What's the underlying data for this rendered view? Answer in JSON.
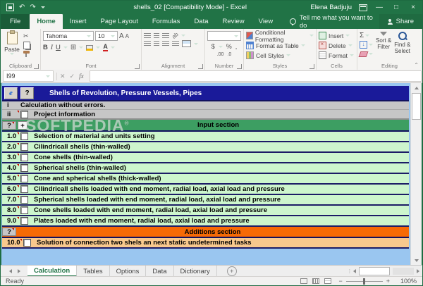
{
  "window": {
    "title": "shells_02  [Compatibility Mode] - Excel",
    "user": "Elena Badjuju"
  },
  "ribbon_tabs": {
    "file": "File",
    "items": [
      "Home",
      "Insert",
      "Page Layout",
      "Formulas",
      "Data",
      "Review",
      "View"
    ],
    "active": "Home",
    "tell_me": "Tell me what you want to do",
    "share": "Share"
  },
  "ribbon": {
    "clipboard": {
      "caption": "Clipboard",
      "paste": "Paste"
    },
    "font": {
      "caption": "Font",
      "family": "Tahoma",
      "size": "10",
      "bold": "B",
      "italic": "I",
      "underline": "U",
      "grow": "A",
      "shrink": "A",
      "color": "A"
    },
    "alignment": {
      "caption": "Alignment",
      "orientation": "ab"
    },
    "number": {
      "caption": "Number",
      "currency": "$",
      "percent": "%",
      "comma": ",",
      "inc_decimal": ".00",
      "dec_decimal": ".0"
    },
    "styles": {
      "caption": "Styles",
      "items": [
        "Conditional Formatting",
        "Format as Table",
        "Cell Styles"
      ]
    },
    "cells": {
      "caption": "Cells",
      "items": [
        "Insert",
        "Delete",
        "Format"
      ]
    },
    "editing": {
      "caption": "Editing",
      "sort_filter_1": "Sort &",
      "sort_filter_2": "Filter",
      "find_select_1": "Find &",
      "find_select_2": "Select",
      "az": "AZ"
    }
  },
  "formula_bar": {
    "name_box": "I99",
    "cancel": "✕",
    "enter": "✓",
    "fx": "fx"
  },
  "sheet": {
    "header_title": "Shells of Revolution, Pressure Vessels, Pipes",
    "ie_icon": "e",
    "help_icon": "?",
    "watermark": "SOFTPEDIA",
    "watermark_reg": "®",
    "rows": [
      {
        "label": "i",
        "text": "Calculation without errors."
      },
      {
        "label": "ii",
        "text": "Project information"
      },
      {
        "label": "?",
        "text": "Input section"
      },
      {
        "label": "1.0",
        "text": "Selection of material and units setting"
      },
      {
        "label": "2.0",
        "text": "Cilindricall shells (thin-walled)"
      },
      {
        "label": "3.0",
        "text": "Cone shells (thin-walled)"
      },
      {
        "label": "4.0",
        "text": "Spherical shells (thin-walled)"
      },
      {
        "label": "5.0",
        "text": "Cone and spherical shells (thick-walled)"
      },
      {
        "label": "6.0",
        "text": "Cilindricall shells loaded with end moment, radial load, axial load and pressure"
      },
      {
        "label": "7.0",
        "text": "Spherical shells loaded with end moment, radial load, axial load and pressure"
      },
      {
        "label": "8.0",
        "text": "Cone shells loaded with end moment, radial load, axial load and pressure"
      },
      {
        "label": "9.0",
        "text": "Plates loaded with end moment, radial load, axial load and pressure"
      },
      {
        "label": "?",
        "text": "Additions section"
      },
      {
        "label": "10.0",
        "text": "Solution of connection two shels an next static undetermined tasks"
      }
    ]
  },
  "sheet_tabs": {
    "items": [
      "Calculation",
      "Tables",
      "Options",
      "Data",
      "Dictionary"
    ],
    "active": "Calculation",
    "new_sheet": "+"
  },
  "status_bar": {
    "mode": "Ready",
    "zoom_out": "−",
    "zoom_in": "+",
    "zoom_level": "100%"
  },
  "icons": {
    "cut": "✂",
    "undo": "↶",
    "redo": "↷",
    "sum": "Σ",
    "plus": "+",
    "filldown": "↓",
    "collapse": "⌃"
  },
  "colors": {
    "accent": "#217346",
    "navy_header": "#1a1a99",
    "gray_row": "#c6c6c6",
    "section_green": "#3d9e62",
    "item_green": "#cdf6cd",
    "section_orange": "#f66a05",
    "item_orange": "#f8c88d",
    "sheet_bg": "#9ac6f0"
  }
}
